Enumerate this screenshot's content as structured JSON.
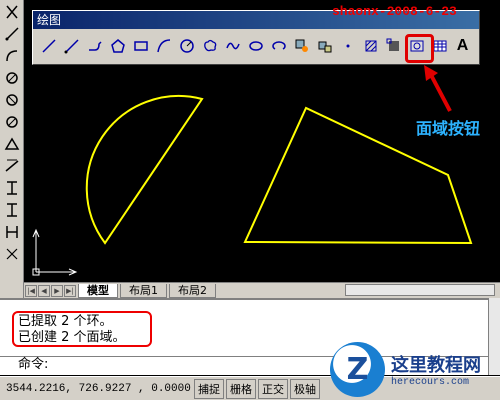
{
  "watermark": "shaonx-2008-6-23",
  "toolbar": {
    "title": "绘图",
    "icons": [
      "line-icon",
      "ray-icon",
      "polyline-icon",
      "polygon-icon",
      "rectangle-icon",
      "arc-icon",
      "circle-icon",
      "revcloud-icon",
      "spline-icon",
      "ellipse-icon",
      "ellipse-arc-icon",
      "insert-block-icon",
      "make-block-icon",
      "point-icon",
      "hatch-icon",
      "gradient-icon",
      "region-icon",
      "table-icon",
      "mtext-icon"
    ]
  },
  "callout": "面域按钮",
  "tabs": [
    "模型",
    "布局1",
    "布局2"
  ],
  "command": {
    "line1": "已提取  2  个环。",
    "line2": "已创建  2  个面域。",
    "prompt": "命令:"
  },
  "status": {
    "coords": "3544.2216, 726.9227 , 0.0000",
    "buttons": [
      "捕捉",
      "栅格",
      "正交",
      "极轴"
    ]
  },
  "logo": {
    "letter": "Z",
    "name": "这里教程网",
    "url": "herecours.com"
  },
  "colors": {
    "drawing": "#ffff00",
    "highlight": "#e00000",
    "callout": "#2db3ff"
  }
}
